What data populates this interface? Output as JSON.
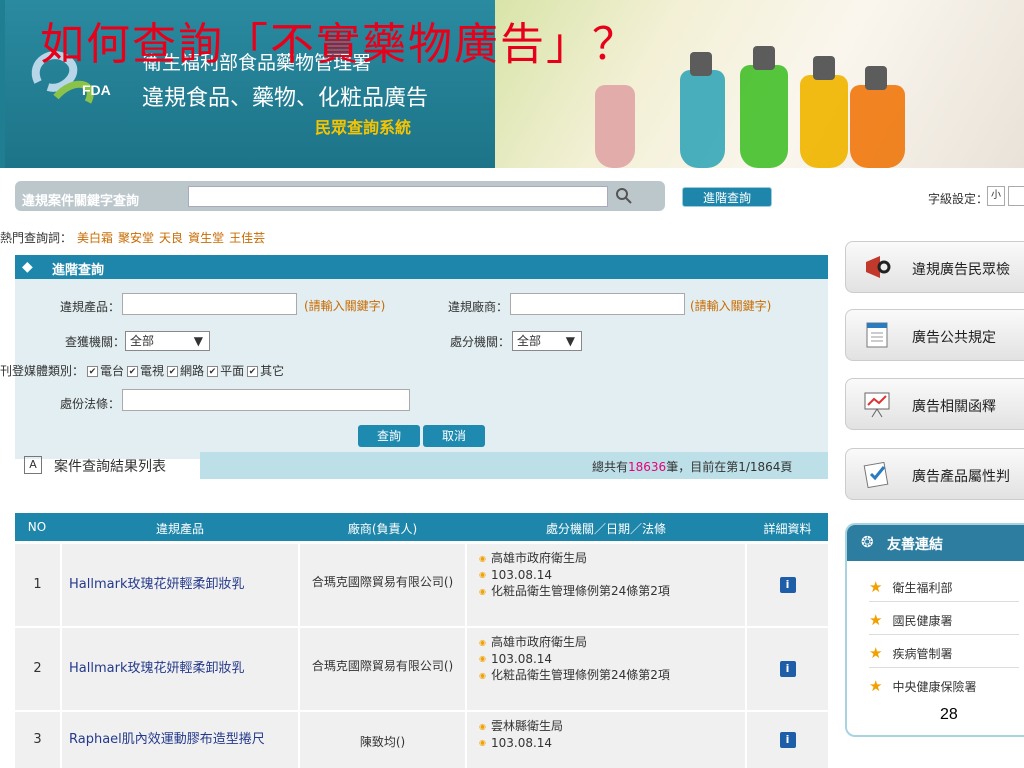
{
  "slide_title": "如何查詢「不實藥物廣告」？",
  "header": {
    "org_name": "衛生福利部食品藥物管理署",
    "logo_text": "FDA",
    "system_name": "違規食品、藥物、化粧品廣告",
    "system_sub": "民眾查詢系統"
  },
  "search": {
    "label": "違規案件關鍵字查詢",
    "value": "",
    "advanced_button": "進階查詢",
    "font_size_label": "字級設定："
  },
  "hot": {
    "label": "熱門查詢詞：",
    "words": [
      "美白霜",
      "聚安堂",
      "天良",
      "資生堂",
      "王佳芸"
    ]
  },
  "advanced": {
    "title": "進階查詢",
    "product_label": "違規產品：",
    "product_value": "",
    "product_hint": "(請輸入關鍵字)",
    "vendor_label": "違規廠商：",
    "vendor_value": "",
    "vendor_hint": "(請輸入關鍵字)",
    "agency_label": "查獲機關：",
    "agency_value": "全部",
    "penalty_agency_label": "處分機關：",
    "penalty_agency_value": "全部",
    "media_label": "刊登媒體類別：",
    "media": [
      "電台",
      "電視",
      "網路",
      "平面",
      "其它"
    ],
    "law_label": "處份法條：",
    "law_value": "",
    "query_button": "查詢",
    "cancel_button": "取消"
  },
  "results": {
    "title": "案件查詢結果列表",
    "count_prefix": "總共有",
    "count": "18636",
    "count_suffix": "筆，目前在第1/1864頁",
    "columns": [
      "NO",
      "違規產品",
      "廠商(負責人)",
      "處分機關／日期／法條",
      "詳細資料"
    ],
    "rows": [
      {
        "no": "1",
        "product": "Hallmark玫瑰花妍輕柔卸妝乳",
        "vendor": "合瑪克國際貿易有限公司()",
        "agency": "高雄市政府衛生局",
        "date": "103.08.14",
        "law": "化粧品衛生管理條例第24條第2項"
      },
      {
        "no": "2",
        "product": "Hallmark玫瑰花妍輕柔卸妝乳",
        "vendor": "合瑪克國際貿易有限公司()",
        "agency": "高雄市政府衛生局",
        "date": "103.08.14",
        "law": "化粧品衛生管理條例第24條第2項"
      },
      {
        "no": "3",
        "product": "Raphael肌內效運動膠布造型捲尺",
        "vendor": "陳致均()",
        "agency": "雲林縣衛生局",
        "date": "103.08.14",
        "law": ""
      }
    ]
  },
  "sidebar": {
    "buttons": [
      "違規廣告民眾檢",
      "廣告公共規定",
      "廣告相關函釋",
      "廣告產品屬性判"
    ],
    "links_title": "友善連結",
    "links": [
      "衛生福利部",
      "國民健康署",
      "疾病管制署",
      "中央健康保險署"
    ]
  },
  "slide_number": "28"
}
